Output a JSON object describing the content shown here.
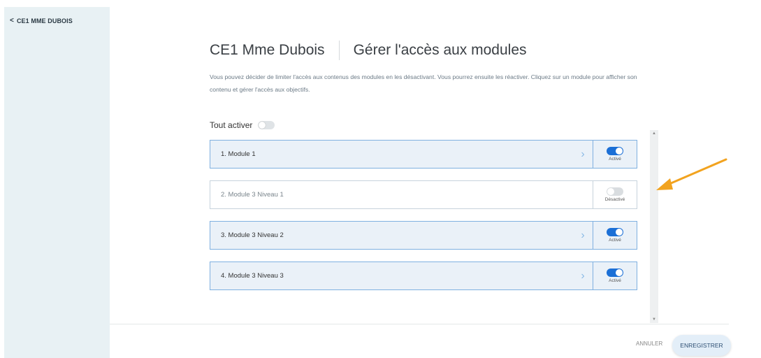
{
  "sidebar": {
    "back_label": "CE1 MME DUBOIS",
    "back_icon": "chevron-left-icon"
  },
  "header": {
    "class_name": "CE1 Mme Dubois",
    "page_title": "Gérer l'accès aux modules"
  },
  "description": "Vous pouvez décider de limiter l'accès aux contenus des modules en les désactivant. Vous pourrez ensuite les réactiver. Cliquez sur un module pour afficher son contenu et gérer l'accès aux objectifs.",
  "tout_activer": {
    "label": "Tout activer",
    "enabled": false
  },
  "modules": [
    {
      "label": "1. Module 1",
      "state_label": "Activé",
      "enabled": true
    },
    {
      "label": "2. Module 3 Niveau 1",
      "state_label": "Désactivé",
      "enabled": false
    },
    {
      "label": "3. Module 3 Niveau 2",
      "state_label": "Activé",
      "enabled": true
    },
    {
      "label": "4. Module 3 Niveau 3",
      "state_label": "Activé",
      "enabled": true
    }
  ],
  "footer": {
    "cancel_label": "ANNULER",
    "save_label": "ENREGISTRER"
  },
  "colors": {
    "sidebar_bg": "#e8f1f4",
    "accent_blue": "#1b6fd6",
    "active_row_bg": "#eaf1f8",
    "annotation_arrow": "#f2a31f"
  }
}
